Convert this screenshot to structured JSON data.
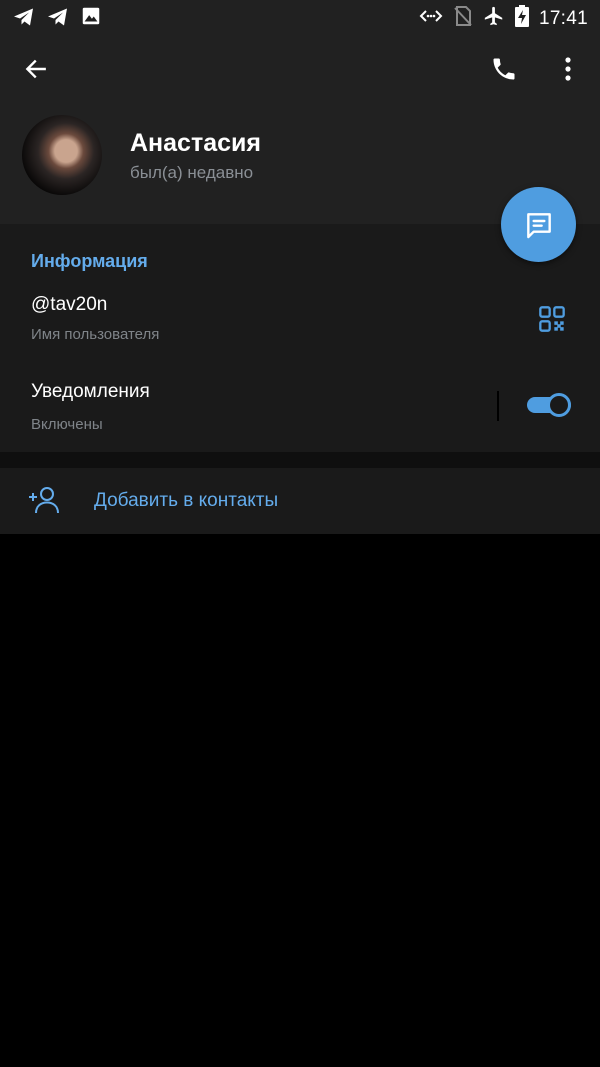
{
  "statusbar": {
    "time": "17:41",
    "left_icons": [
      "telegram-icon",
      "telegram-icon",
      "image-icon"
    ],
    "right_icons": [
      "data-transfer-icon",
      "no-sim-icon",
      "airplane-icon",
      "battery-charging-icon"
    ]
  },
  "header": {
    "name": "Анастасия",
    "status": "был(а) недавно",
    "actions": [
      "back-arrow-icon",
      "phone-icon",
      "more-vertical-icon"
    ]
  },
  "info": {
    "section_title": "Информация",
    "username": "@tav20n",
    "username_label": "Имя пользователя",
    "notifications_label": "Уведомления",
    "notifications_value": "Включены",
    "notifications_on": true
  },
  "actions": {
    "add_contact": "Добавить в контакты"
  },
  "colors": {
    "accent": "#4f9de0",
    "accent_text": "#64acec",
    "header_bg": "#212121",
    "section_bg": "#1a1a1a",
    "page_bg": "#000000"
  }
}
